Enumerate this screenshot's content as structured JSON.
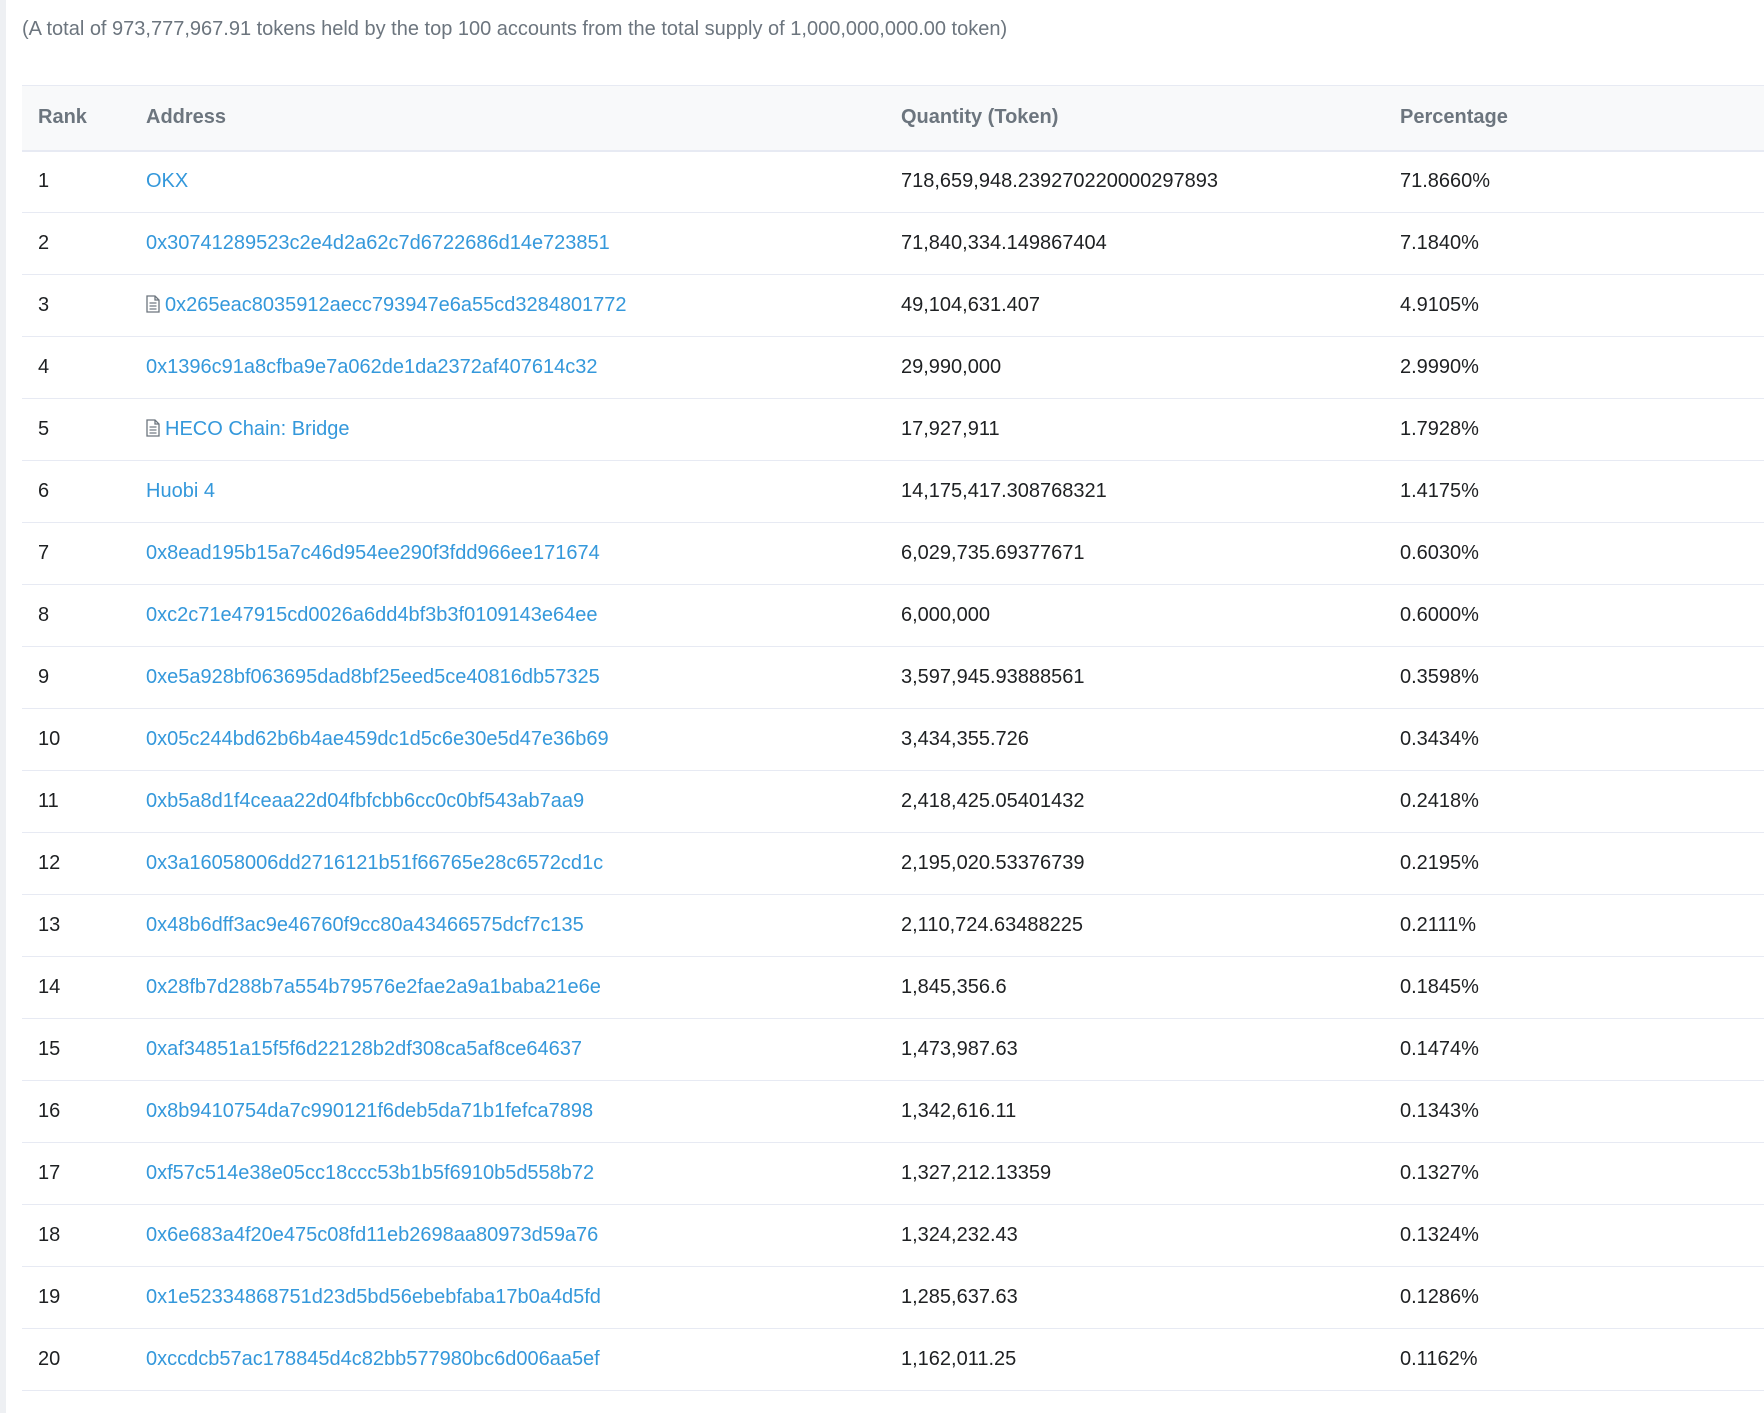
{
  "summary": "(A total of 973,777,967.91 tokens held by the top 100 accounts from the total supply of 1,000,000,000.00 token)",
  "table": {
    "headers": {
      "rank": "Rank",
      "address": "Address",
      "quantity": "Quantity (Token)",
      "percentage": "Percentage"
    },
    "rows": [
      {
        "rank": "1",
        "address": "OKX",
        "is_contract": false,
        "quantity": "718,659,948.239270220000297893",
        "percentage": "71.8660%"
      },
      {
        "rank": "2",
        "address": "0x30741289523c2e4d2a62c7d6722686d14e723851",
        "is_contract": false,
        "quantity": "71,840,334.149867404",
        "percentage": "7.1840%"
      },
      {
        "rank": "3",
        "address": "0x265eac8035912aecc793947e6a55cd3284801772",
        "is_contract": true,
        "quantity": "49,104,631.407",
        "percentage": "4.9105%"
      },
      {
        "rank": "4",
        "address": "0x1396c91a8cfba9e7a062de1da2372af407614c32",
        "is_contract": false,
        "quantity": "29,990,000",
        "percentage": "2.9990%"
      },
      {
        "rank": "5",
        "address": "HECO Chain: Bridge",
        "is_contract": true,
        "quantity": "17,927,911",
        "percentage": "1.7928%"
      },
      {
        "rank": "6",
        "address": "Huobi 4",
        "is_contract": false,
        "quantity": "14,175,417.308768321",
        "percentage": "1.4175%"
      },
      {
        "rank": "7",
        "address": "0x8ead195b15a7c46d954ee290f3fdd966ee171674",
        "is_contract": false,
        "quantity": "6,029,735.69377671",
        "percentage": "0.6030%"
      },
      {
        "rank": "8",
        "address": "0xc2c71e47915cd0026a6dd4bf3b3f0109143e64ee",
        "is_contract": false,
        "quantity": "6,000,000",
        "percentage": "0.6000%"
      },
      {
        "rank": "9",
        "address": "0xe5a928bf063695dad8bf25eed5ce40816db57325",
        "is_contract": false,
        "quantity": "3,597,945.93888561",
        "percentage": "0.3598%"
      },
      {
        "rank": "10",
        "address": "0x05c244bd62b6b4ae459dc1d5c6e30e5d47e36b69",
        "is_contract": false,
        "quantity": "3,434,355.726",
        "percentage": "0.3434%"
      },
      {
        "rank": "11",
        "address": "0xb5a8d1f4ceaa22d04fbfcbb6cc0c0bf543ab7aa9",
        "is_contract": false,
        "quantity": "2,418,425.05401432",
        "percentage": "0.2418%"
      },
      {
        "rank": "12",
        "address": "0x3a16058006dd2716121b51f66765e28c6572cd1c",
        "is_contract": false,
        "quantity": "2,195,020.53376739",
        "percentage": "0.2195%"
      },
      {
        "rank": "13",
        "address": "0x48b6dff3ac9e46760f9cc80a43466575dcf7c135",
        "is_contract": false,
        "quantity": "2,110,724.63488225",
        "percentage": "0.2111%"
      },
      {
        "rank": "14",
        "address": "0x28fb7d288b7a554b79576e2fae2a9a1baba21e6e",
        "is_contract": false,
        "quantity": "1,845,356.6",
        "percentage": "0.1845%"
      },
      {
        "rank": "15",
        "address": "0xaf34851a15f5f6d22128b2df308ca5af8ce64637",
        "is_contract": false,
        "quantity": "1,473,987.63",
        "percentage": "0.1474%"
      },
      {
        "rank": "16",
        "address": "0x8b9410754da7c990121f6deb5da71b1fefca7898",
        "is_contract": false,
        "quantity": "1,342,616.11",
        "percentage": "0.1343%"
      },
      {
        "rank": "17",
        "address": "0xf57c514e38e05cc18ccc53b1b5f6910b5d558b72",
        "is_contract": false,
        "quantity": "1,327,212.13359",
        "percentage": "0.1327%"
      },
      {
        "rank": "18",
        "address": "0x6e683a4f20e475c08fd11eb2698aa80973d59a76",
        "is_contract": false,
        "quantity": "1,324,232.43",
        "percentage": "0.1324%"
      },
      {
        "rank": "19",
        "address": "0x1e52334868751d23d5bd56ebebfaba17b0a4d5fd",
        "is_contract": false,
        "quantity": "1,285,637.63",
        "percentage": "0.1286%"
      },
      {
        "rank": "20",
        "address": "0xccdcb57ac178845d4c82bb577980bc6d006aa5ef",
        "is_contract": false,
        "quantity": "1,162,011.25",
        "percentage": "0.1162%"
      }
    ]
  },
  "colors": {
    "link": "#3498db",
    "header_text": "#6c757e",
    "body_text": "#1e2022",
    "border": "#e7eaf3"
  },
  "icons": {
    "contract": "file-text-icon"
  }
}
